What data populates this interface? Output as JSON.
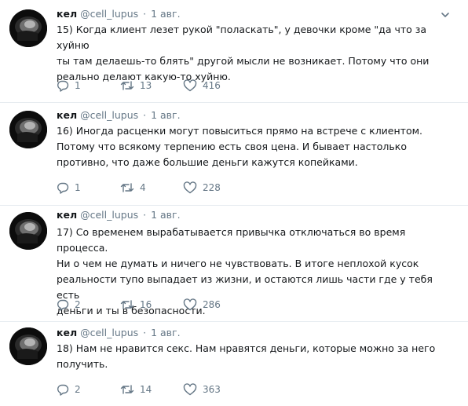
{
  "tweets": [
    {
      "name": "кел",
      "handle": "@cell_lupus",
      "separator": "·",
      "date": "1 авг.",
      "text": "15) Когда клиент лезет рукой \"поласкать\", у девочки кроме \"да что за хуйню\nты там делаешь-то блять\" другой мысли не возникает. Потому что они\nреально делают какую-то хуйню.",
      "replies": "1",
      "retweets": "13",
      "likes": "416"
    },
    {
      "name": "кел",
      "handle": "@cell_lupus",
      "separator": "·",
      "date": "1 авг.",
      "text": "16) Иногда расценки могут повыситься прямо на встрече с клиентом.\nПотому что всякому терпению есть своя цена. И бывает настолько\nпротивно, что даже большие деньги кажутся копейками.",
      "replies": "1",
      "retweets": "4",
      "likes": "228"
    },
    {
      "name": "кел",
      "handle": "@cell_lupus",
      "separator": "·",
      "date": "1 авг.",
      "text": "17) Со временем вырабатывается привычка отключаться во время процесса.\nНи о чем не думать и ничего не чувствовать. В итоге неплохой кусок\nреальности тупо выпадает из жизни, и остаются лишь части где у тебя есть\nденьги и ты в безопасности.",
      "replies": "2",
      "retweets": "16",
      "likes": "286"
    },
    {
      "name": "кел",
      "handle": "@cell_lupus",
      "separator": "·",
      "date": "1 авг.",
      "text": "18) Нам не нравится секс. Нам нравятся деньги, которые можно за него\nполучить.",
      "replies": "2",
      "retweets": "14",
      "likes": "363"
    }
  ],
  "icons": {
    "reply": "reply-icon",
    "retweet": "retweet-icon",
    "like": "heart-icon",
    "more": "chevron-down-icon"
  },
  "colors": {
    "text": "#14171a",
    "muted": "#657786",
    "divider": "#e6ecf0"
  }
}
